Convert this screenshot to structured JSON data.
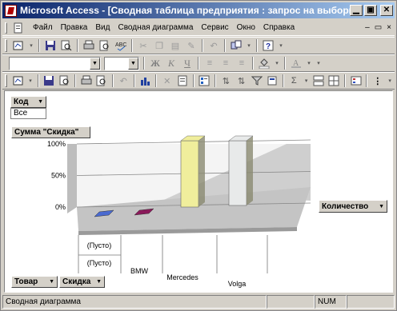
{
  "window": {
    "title": "Microsoft Access - [Сводная таблица предприятия : запрос на выборку]"
  },
  "menu": {
    "items": [
      "Файл",
      "Правка",
      "Вид",
      "Сводная диаграмма",
      "Сервис",
      "Окно",
      "Справка"
    ]
  },
  "pivot": {
    "filter_field": "Код",
    "filter_value": "Все",
    "data_field": "Сумма \"Скидка\"",
    "series_field": "Количество",
    "category_fields": [
      "Товар",
      "Скидка"
    ]
  },
  "chart_data": {
    "type": "bar",
    "style": "3d",
    "y_ticks": [
      "100%",
      "50%",
      "0%"
    ],
    "ylim": [
      0,
      1
    ],
    "categories": [
      "(Пусто)",
      "BMW",
      "Mercedes",
      "Volga"
    ],
    "category_groups": [
      "(Пусто)"
    ],
    "values": [
      0.03,
      0.03,
      1.0,
      1.0
    ],
    "colors": [
      "#4a6ad0",
      "#8a1a5a",
      "#f0ee9c",
      "#e8eaea"
    ]
  },
  "status": {
    "text": "Сводная диаграмма",
    "num": "NUM"
  }
}
